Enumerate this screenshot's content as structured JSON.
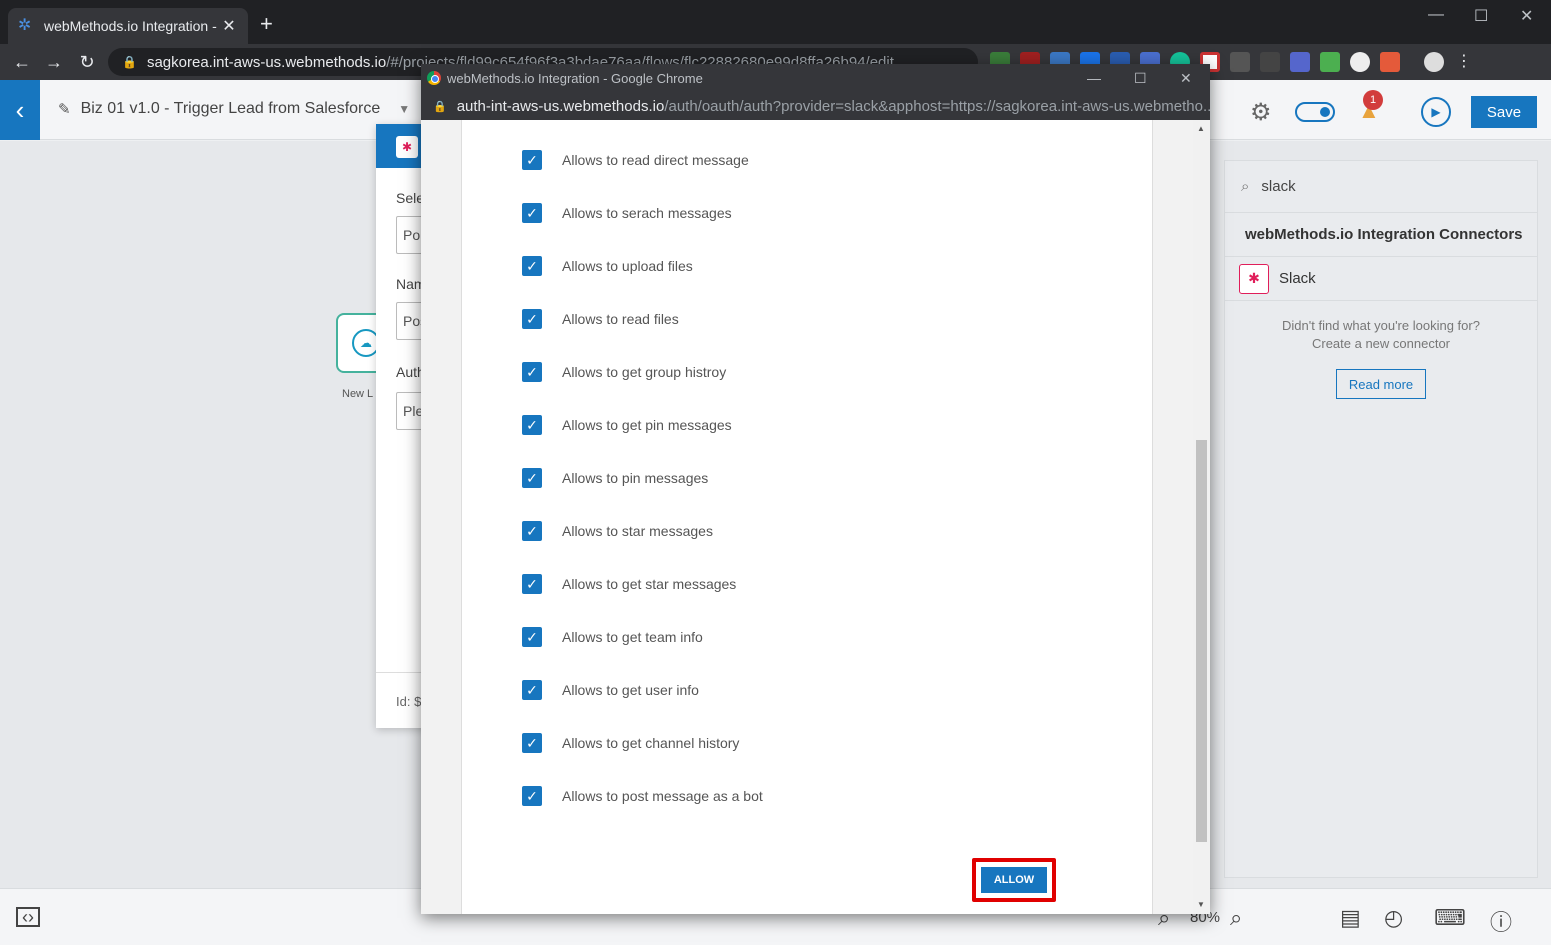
{
  "browser": {
    "tab_title": "webMethods.io Integration - Biz",
    "tab_close": "✕",
    "new_tab": "+",
    "url_host": "sagkorea.int-aws-us.webmethods.io",
    "url_path": "/#/projects/fld99c654f96f3a3bdae76aa/flows/flc22882680e99d8ffa26b94/edit"
  },
  "app": {
    "flow_title": "Biz 01 v1.0 - Trigger Lead from Salesforce",
    "notification_count": "1",
    "save_label": "Save",
    "trigger_label": "New L",
    "config_panel": {
      "select_label": "Sele",
      "select_value": "Po",
      "name_label": "Nam",
      "name_value": "Pos",
      "auth_label": "Auth",
      "auth_value": "Ple",
      "id_label": "Id: $"
    },
    "connectors": {
      "search_value": "slack",
      "section_header": "webMethods.io Integration Connectors",
      "items": [
        {
          "name": "Slack"
        }
      ],
      "empty_line1": "Didn't find what you're looking for?",
      "empty_line2": "Create a new connector",
      "read_more": "Read more"
    },
    "zoom": "80%"
  },
  "popup": {
    "window_title": "webMethods.io Integration - Google Chrome",
    "url_host": "auth-int-aws-us.webmethods.io",
    "url_path": "/auth/oauth/auth?provider=slack&apphost=https://sagkorea.int-aws-us.webmetho...",
    "permissions": [
      {
        "label": "Allows to read direct message",
        "checked": true
      },
      {
        "label": "Allows to serach messages",
        "checked": true
      },
      {
        "label": "Allows to upload files",
        "checked": true
      },
      {
        "label": "Allows to read files",
        "checked": true
      },
      {
        "label": "Allows to get group histroy",
        "checked": true
      },
      {
        "label": "Allows to get pin messages",
        "checked": true
      },
      {
        "label": "Allows to pin messages",
        "checked": true
      },
      {
        "label": "Allows to star messages",
        "checked": true
      },
      {
        "label": "Allows to get star messages",
        "checked": true
      },
      {
        "label": "Allows to get team info",
        "checked": true
      },
      {
        "label": "Allows to get user info",
        "checked": true
      },
      {
        "label": "Allows to get channel history",
        "checked": true
      },
      {
        "label": "Allows to post message as a bot",
        "checked": true
      }
    ],
    "allow_label": "ALLOW"
  },
  "colors": {
    "brand_blue": "#1776bf",
    "highlight_red": "#e00000",
    "slack_pink": "#e01e5a"
  }
}
